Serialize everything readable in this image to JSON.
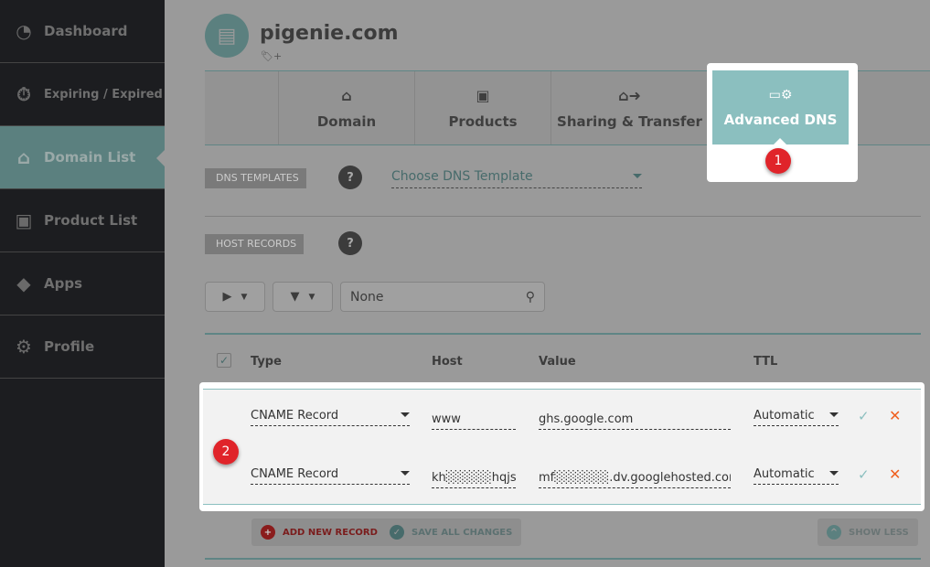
{
  "sidebar": {
    "items": [
      {
        "label": "Dashboard",
        "icon": "dashboard-gauge-icon"
      },
      {
        "label": "Expiring / Expired",
        "icon": "stopwatch-icon"
      },
      {
        "label": "Domain List",
        "icon": "home-icon",
        "active": true
      },
      {
        "label": "Product List",
        "icon": "box-icon"
      },
      {
        "label": "Apps",
        "icon": "apps-icon"
      },
      {
        "label": "Profile",
        "icon": "gear-icon"
      }
    ]
  },
  "header": {
    "domain": "pigenie.com"
  },
  "tabs": [
    {
      "label": "Domain",
      "icon": "home-icon"
    },
    {
      "label": "Products",
      "icon": "box-icon"
    },
    {
      "label": "Sharing & Transfer",
      "icon": "transfer-icon"
    },
    {
      "label": "Advanced DNS",
      "icon": "dns-server-icon",
      "active": true
    }
  ],
  "annotations": {
    "step1": "1",
    "step2": "2"
  },
  "dns_templates": {
    "label": "DNS TEMPLATES",
    "help": "?",
    "select": "Choose DNS Template"
  },
  "host_records": {
    "label": "HOST RECORDS",
    "help": "?",
    "filter_value": "None"
  },
  "table": {
    "headers": {
      "type": "Type",
      "host": "Host",
      "value": "Value",
      "ttl": "TTL"
    },
    "rows": [
      {
        "type": "CNAME Record",
        "host": "www",
        "value": "ghs.google.com",
        "ttl": "Automatic"
      },
      {
        "type": "CNAME Record",
        "host": "kh░░░░░hqjs",
        "value": "mf░░░░░░.dv.googlehosted.com",
        "ttl": "Automatic"
      }
    ]
  },
  "actions": {
    "add": "ADD NEW RECORD",
    "save": "SAVE ALL CHANGES",
    "show_less": "SHOW LESS"
  },
  "colors": {
    "accent": "#8bbfbf",
    "badge": "#e0242a",
    "delete": "#f06020",
    "add": "#a02020"
  }
}
